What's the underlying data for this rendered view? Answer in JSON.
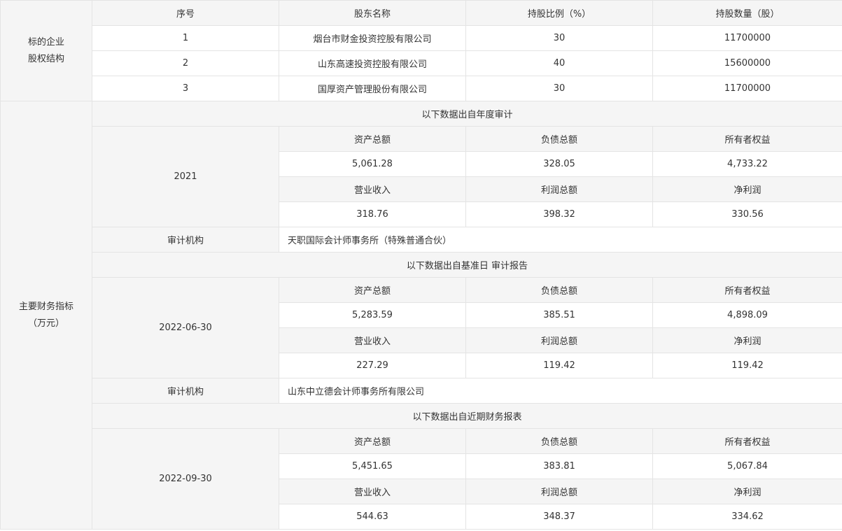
{
  "equity": {
    "label_lines": [
      "标的企业",
      "股权结构"
    ],
    "headers": [
      "序号",
      "股东名称",
      "持股比例（%）",
      "持股数量（股）"
    ],
    "rows": [
      [
        "1",
        "烟台市财金投资控股有限公司",
        "30",
        "11700000"
      ],
      [
        "2",
        "山东高速投资控股有限公司",
        "40",
        "15600000"
      ],
      [
        "3",
        "国厚资产管理股份有限公司",
        "30",
        "11700000"
      ]
    ]
  },
  "finance": {
    "label_lines": [
      "主要财务指标",
      "（万元）"
    ],
    "audit_label": "审计机构",
    "blocks": [
      {
        "source": "以下数据出自年度审计",
        "date": "2021",
        "h1": [
          "资产总额",
          "负债总额",
          "所有者权益"
        ],
        "v1": [
          "5,061.28",
          "328.05",
          "4,733.22"
        ],
        "h2": [
          "营业收入",
          "利润总额",
          "净利润"
        ],
        "v2": [
          "318.76",
          "398.32",
          "330.56"
        ],
        "auditor": "天职国际会计师事务所（特殊普通合伙）"
      },
      {
        "source": "以下数据出自基准日 审计报告",
        "date": "2022-06-30",
        "h1": [
          "资产总额",
          "负债总额",
          "所有者权益"
        ],
        "v1": [
          "5,283.59",
          "385.51",
          "4,898.09"
        ],
        "h2": [
          "营业收入",
          "利润总额",
          "净利润"
        ],
        "v2": [
          "227.29",
          "119.42",
          "119.42"
        ],
        "auditor": "山东中立德会计师事务所有限公司"
      },
      {
        "source": "以下数据出自近期财务报表",
        "date": "2022-09-30",
        "h1": [
          "资产总额",
          "负债总额",
          "所有者权益"
        ],
        "v1": [
          "5,451.65",
          "383.81",
          "5,067.84"
        ],
        "h2": [
          "营业收入",
          "利润总额",
          "净利润"
        ],
        "v2": [
          "544.63",
          "348.37",
          "334.62"
        ]
      }
    ]
  },
  "colors": {
    "header_bg": "#f5f5f5",
    "border": "#e4e4e4",
    "text": "#333333"
  }
}
